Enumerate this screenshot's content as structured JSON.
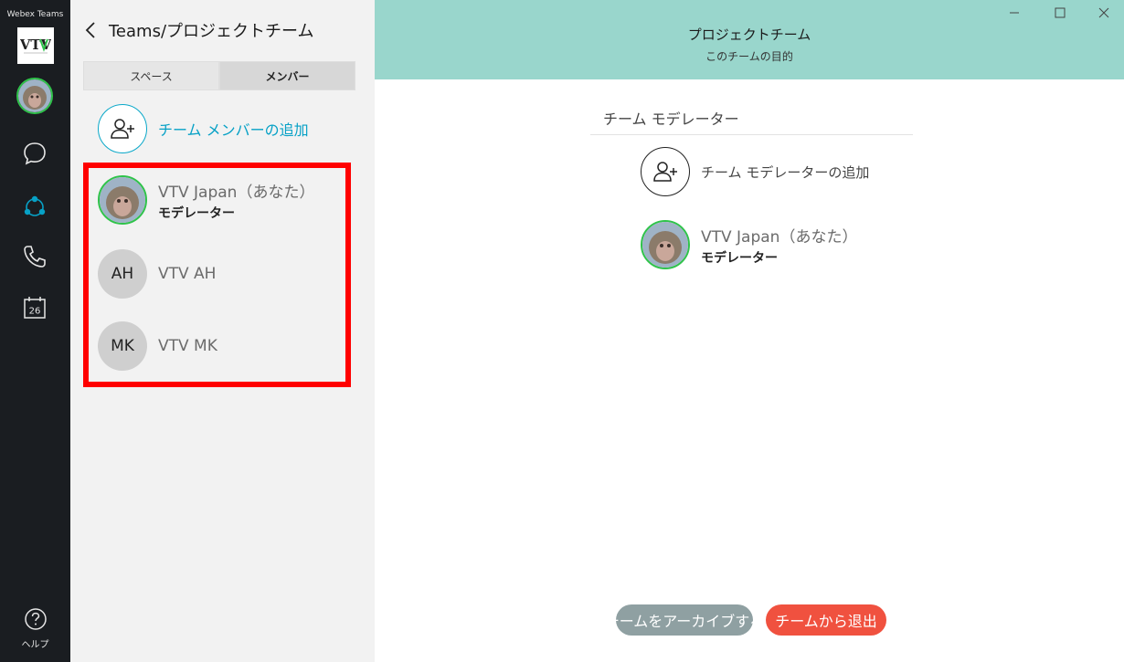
{
  "app": {
    "name": "Webex Teams",
    "logo_text": "VTV"
  },
  "rail": {
    "icons": [
      "chat-icon",
      "teams-icon",
      "phone-icon",
      "calendar-icon"
    ],
    "calendar_day": "26",
    "help_label": "ヘルプ",
    "active_color": "#07a1c6"
  },
  "panel": {
    "title": "Teams/プロジェクトチーム",
    "tabs": [
      {
        "label": "スペース",
        "active": false
      },
      {
        "label": "メンバー",
        "active": true
      }
    ],
    "add_member_label": "チーム メンバーの追加",
    "members": [
      {
        "name": "VTV Japan（あなた）",
        "role": "モデレーター",
        "avatar": "photo"
      },
      {
        "name": "VTV AH",
        "initials": "AH",
        "avatar": "initials"
      },
      {
        "name": "VTV MK",
        "initials": "MK",
        "avatar": "initials"
      }
    ]
  },
  "main": {
    "team_name": "プロジェクトチーム",
    "team_purpose": "このチームの目的",
    "banner_color": "#99d6cc",
    "moderators_heading": "チーム モデレーター",
    "add_moderator_label": "チーム モデレーターの追加",
    "moderators": [
      {
        "name": "VTV Japan（あなた）",
        "role": "モデレーター"
      }
    ],
    "archive_button": "チームをアーカイブする",
    "leave_button": "チームから退出"
  },
  "colors": {
    "accent": "#07a1c6",
    "presence": "#2fc34a",
    "highlight": "#ff0000",
    "leave": "#f0513f",
    "archive": "#8fa0a2"
  }
}
